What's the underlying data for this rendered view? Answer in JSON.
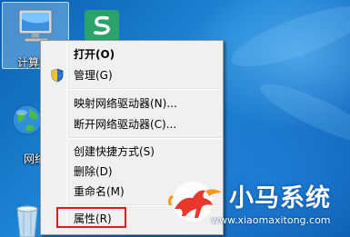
{
  "desktop": {
    "icons": [
      {
        "name": "computer",
        "label": "计算机"
      },
      {
        "name": "green-app",
        "label": ""
      },
      {
        "name": "network",
        "label": "网络"
      },
      {
        "name": "recycle-bin",
        "label": ""
      }
    ]
  },
  "context_menu": {
    "items": [
      {
        "label": "打开(O)",
        "bold": true
      },
      {
        "label": "管理(G)",
        "icon": "shield-icon"
      },
      {
        "label": "映射网络驱动器(N)..."
      },
      {
        "label": "断开网络驱动器(C)..."
      },
      {
        "label": "创建快捷方式(S)"
      },
      {
        "label": "删除(D)"
      },
      {
        "label": "重命名(M)"
      },
      {
        "label": "属性(R)",
        "highlighted": true
      }
    ],
    "highlight_color": "#e11b1b"
  },
  "watermark": {
    "brand": "小马系统",
    "url": "www.xiaomaxitong.com"
  },
  "colors": {
    "desktop_bg": "#1f86d6",
    "menu_bg": "#f0f0f0",
    "green_app": "#2aa36b"
  }
}
